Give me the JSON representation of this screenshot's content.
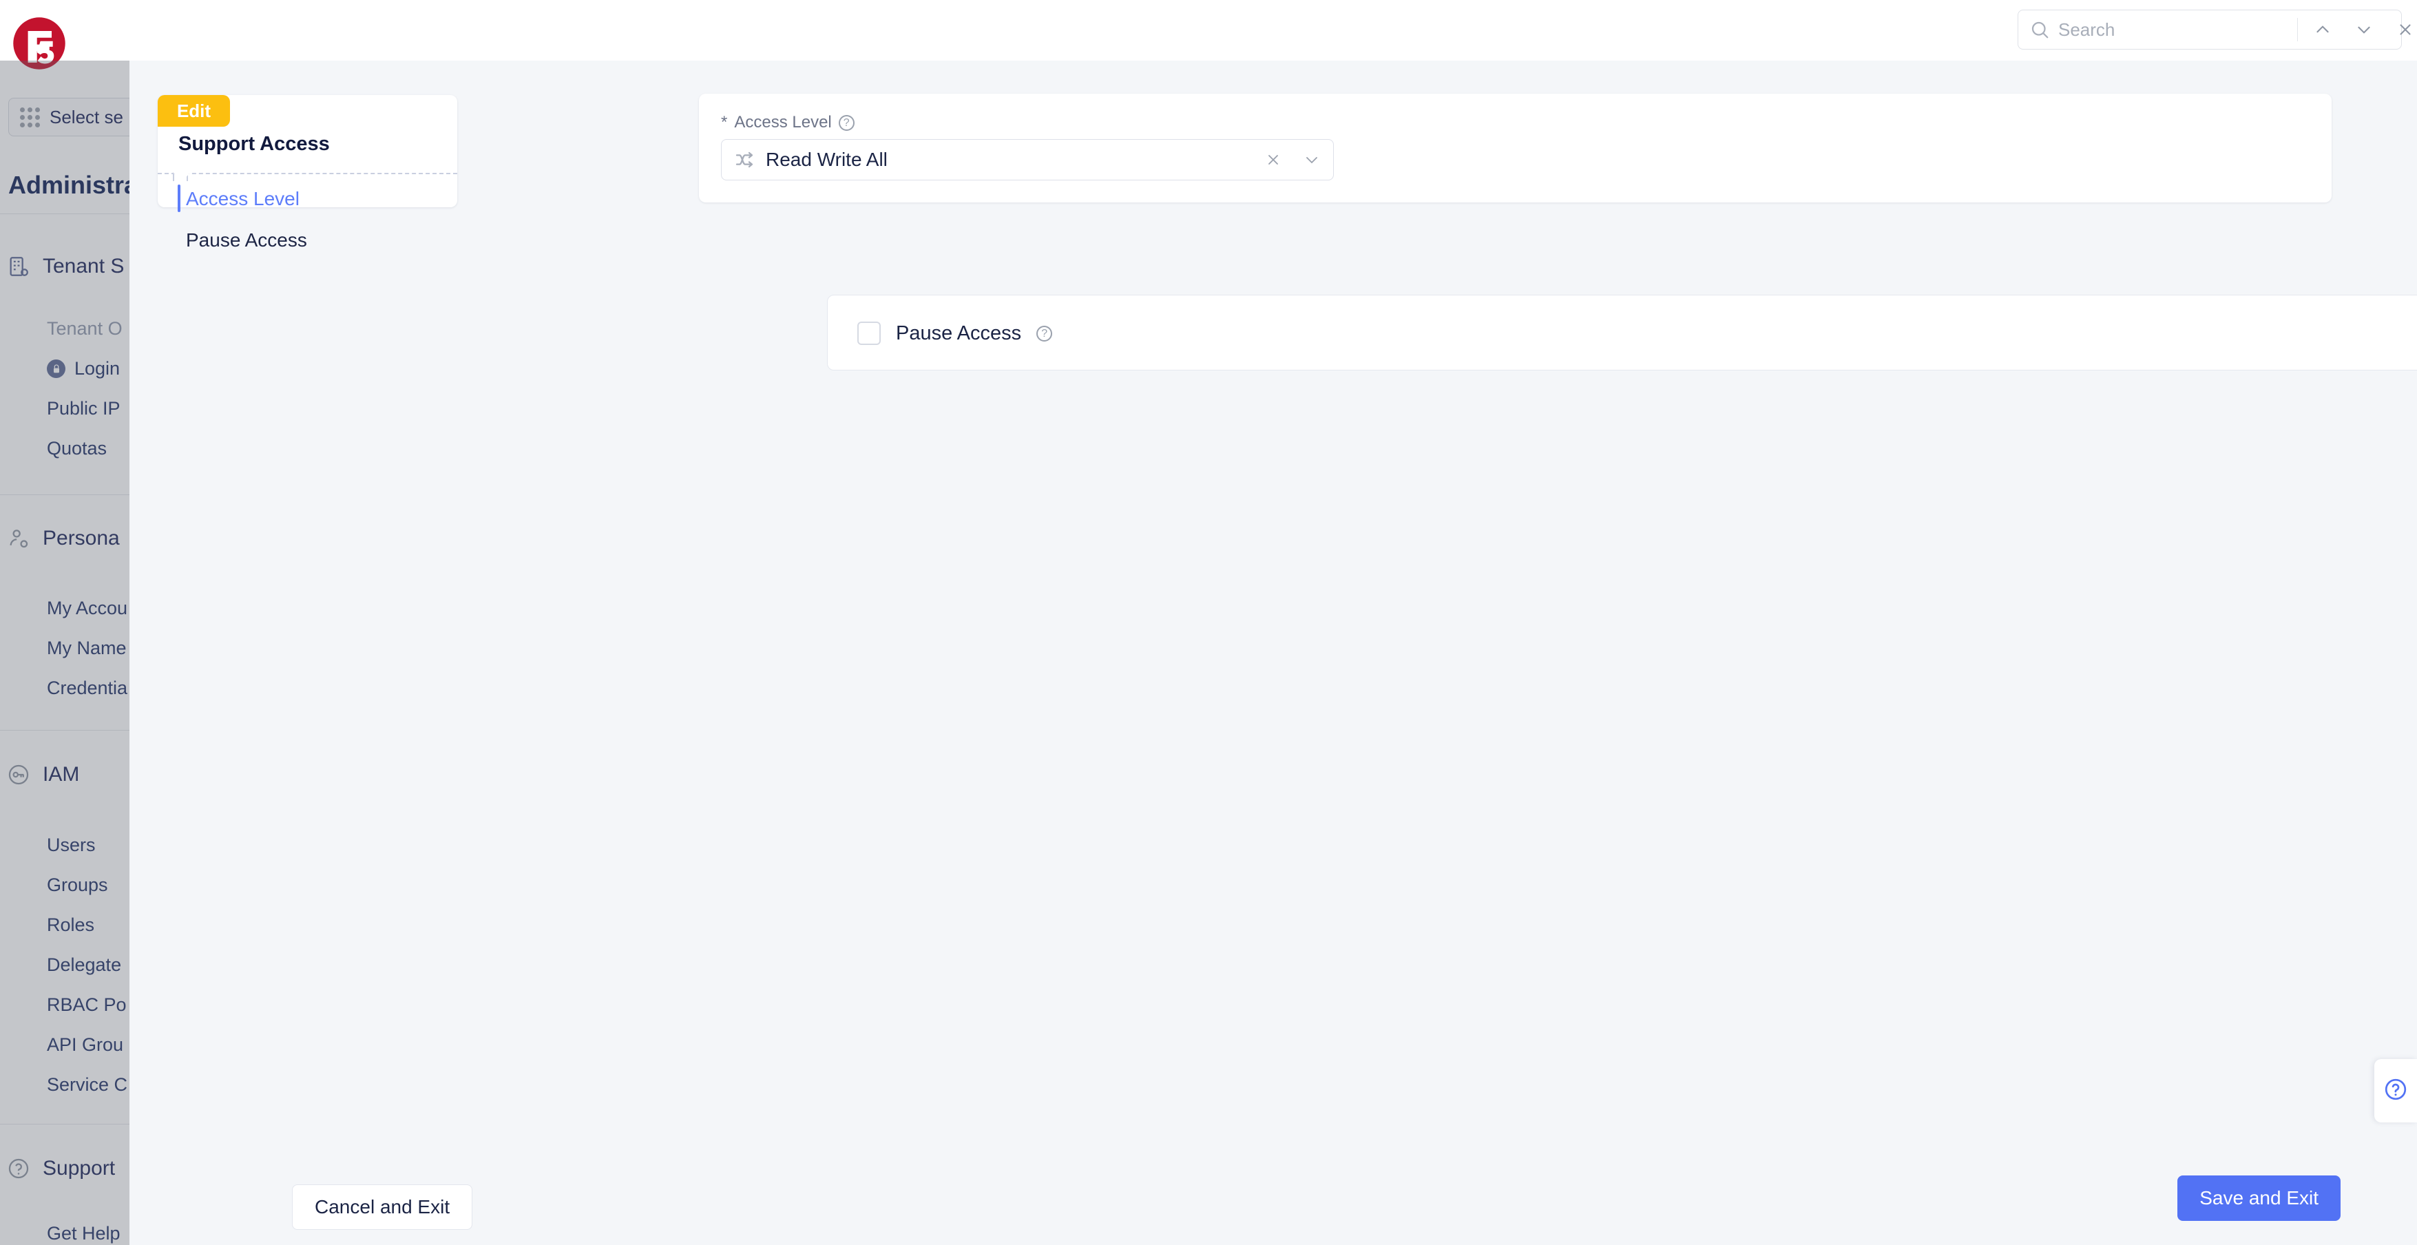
{
  "brand": {
    "logo_alt": "f5",
    "accent": "#c3132e"
  },
  "sidebar": {
    "tenant_selector": {
      "label": "Select se",
      "icon": "grid-apps-icon"
    },
    "section_title": "Administra",
    "groups": [
      {
        "icon": "tenant-settings-icon",
        "label": "Tenant S",
        "items": [
          {
            "label": "Tenant O",
            "muted": true
          },
          {
            "label": "Login",
            "icon": "lock-icon"
          },
          {
            "label": "Public IP"
          },
          {
            "label": "Quotas"
          }
        ]
      },
      {
        "icon": "person-settings-icon",
        "label": "Persona",
        "items": [
          {
            "label": "My Accou"
          },
          {
            "label": "My Name"
          },
          {
            "label": "Credentia"
          }
        ]
      },
      {
        "icon": "key-icon",
        "label": "IAM",
        "items": [
          {
            "label": "Users"
          },
          {
            "label": "Groups"
          },
          {
            "label": "Roles"
          },
          {
            "label": "Delegate"
          },
          {
            "label": "RBAC Po"
          },
          {
            "label": "API Grou"
          },
          {
            "label": "Service C"
          }
        ]
      },
      {
        "icon": "support-icon",
        "label": "Support",
        "items": [
          {
            "label": "Get Help"
          }
        ]
      }
    ]
  },
  "header": {
    "search": {
      "placeholder": "Search",
      "value": "",
      "icon": "search-icon",
      "prev_icon": "chevron-up-icon",
      "next_icon": "chevron-down-icon",
      "close_icon": "close-icon"
    }
  },
  "wizard": {
    "mode_badge": "Edit",
    "title": "Support Access",
    "steps": [
      {
        "label": "Access Level",
        "active": true
      },
      {
        "label": "Pause Access",
        "active": false
      }
    ]
  },
  "form": {
    "access_level": {
      "label": "Access Level",
      "required_marker": "*",
      "help_icon": "question-circle-icon",
      "value": "Read Write All",
      "value_icon": "branch-shuffle-icon",
      "clear_icon": "close-icon",
      "dropdown_icon": "chevron-down-icon"
    },
    "pause_access": {
      "label": "Pause Access",
      "checked": false,
      "help_icon": "question-circle-icon"
    }
  },
  "footer": {
    "cancel_label": "Cancel and Exit",
    "save_label": "Save and Exit",
    "save_color": "#5272f4"
  },
  "help_widget": {
    "icon": "question-circle-icon"
  }
}
